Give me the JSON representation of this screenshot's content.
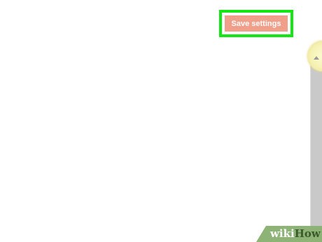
{
  "toolbar": {
    "save_label": "Save settings"
  },
  "colors": {
    "highlight": "#14e614",
    "button": "#f0a08a",
    "scrollbar": "#c9c9c9",
    "watermark_bg": "#8db377"
  },
  "icons": {
    "scroll_up": "chevron-up-icon"
  },
  "watermark": {
    "part1": "wiki",
    "part2": "How"
  }
}
